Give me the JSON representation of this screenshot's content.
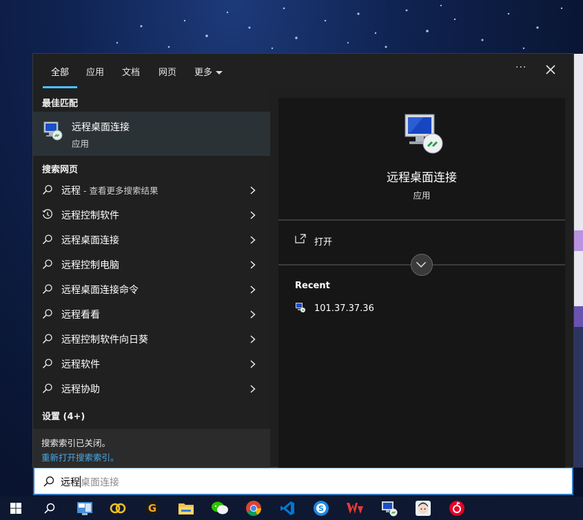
{
  "tabs": [
    {
      "label": "全部",
      "active": true
    },
    {
      "label": "应用"
    },
    {
      "label": "文档"
    },
    {
      "label": "网页"
    },
    {
      "label": "更多"
    }
  ],
  "topbar": {
    "more_icon": "ellipsis-icon",
    "close_icon": "close-icon"
  },
  "left": {
    "best_match_header": "最佳匹配",
    "best_match": {
      "title": "远程桌面连接",
      "subtitle": "应用",
      "icon": "remote-desktop-icon"
    },
    "web_header": "搜索网页",
    "web_items": [
      {
        "text": "远程",
        "suffix": " - 查看更多搜索结果",
        "icon": "search-icon"
      },
      {
        "text": "远程控制软件",
        "suffix": "",
        "icon": "history-icon"
      },
      {
        "text": "远程桌面连接",
        "suffix": "",
        "icon": "search-icon"
      },
      {
        "text": "远程控制电脑",
        "suffix": "",
        "icon": "search-icon"
      },
      {
        "text": "远程桌面连接命令",
        "suffix": "",
        "icon": "search-icon"
      },
      {
        "text": "远程看看",
        "suffix": "",
        "icon": "search-icon"
      },
      {
        "text": "远程控制软件向日葵",
        "suffix": "",
        "icon": "search-icon"
      },
      {
        "text": "远程软件",
        "suffix": "",
        "icon": "search-icon"
      },
      {
        "text": "远程协助",
        "suffix": "",
        "icon": "search-icon"
      }
    ],
    "settings_header": "设置 (4+)",
    "notice": {
      "line1": "搜索索引已关闭。",
      "line2": "重新打开搜索索引。"
    }
  },
  "right": {
    "title": "远程桌面连接",
    "subtitle": "应用",
    "open_label": "打开",
    "recent_header": "Recent",
    "recent_items": [
      "101.37.37.36"
    ]
  },
  "search": {
    "typed": "远程",
    "ghost": "桌面连接"
  },
  "taskbar": {
    "icons": [
      "start-icon",
      "search-icon",
      "control-panel-icon",
      "baidu-netdisk-icon",
      "g-app-icon",
      "file-explorer-icon",
      "wechat-icon",
      "chrome-icon",
      "vscode-icon",
      "sogou-icon",
      "wps-icon",
      "remote-desktop-icon",
      "avatar-app-icon",
      "netease-music-icon"
    ]
  },
  "colors": {
    "accent": "#4cc2ff",
    "panel": "#202020",
    "preview": "#161616",
    "link": "#4aa8e8"
  }
}
